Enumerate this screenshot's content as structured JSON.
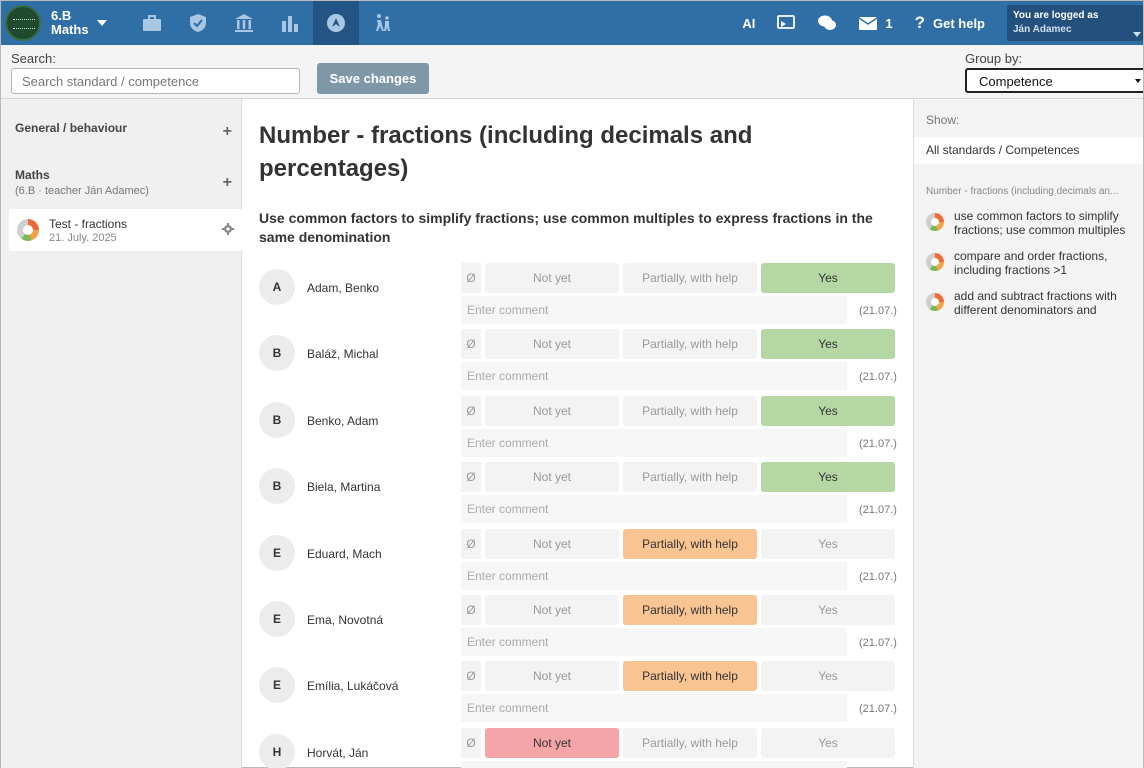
{
  "header": {
    "class_name": "6.B",
    "subject": "Maths",
    "ai_label": "AI",
    "messages_count": "1",
    "help_label": "Get help",
    "logged_in_label": "You are logged as",
    "user_name": "Ján Adamec",
    "nav_icons": [
      "briefcase-icon",
      "shield-icon",
      "building-icon",
      "bar-chart-icon",
      "rocket-badge-icon",
      "walking-people-icon"
    ]
  },
  "toolbar": {
    "search_label": "Search:",
    "search_placeholder": "Search standard / competence",
    "save_label": "Save changes",
    "group_by_label": "Group by:",
    "group_by_value": "Competence"
  },
  "sidebar": {
    "groups": [
      {
        "title": "General / behaviour",
        "subtitle": ""
      },
      {
        "title": "Maths",
        "subtitle": "(6.B · teacher Ján Adamec)"
      }
    ],
    "test_item": {
      "name": "Test - fractions",
      "date": "21. July. 2025"
    }
  },
  "main": {
    "title": "Number - fractions (including decimals and percentages)",
    "subtitle": "Use common factors to simplify fractions; use common multiples to express fractions in the same denomination",
    "option_labels": {
      "none": "Ø",
      "not_yet": "Not yet",
      "partial": "Partially, with help",
      "yes": "Yes"
    },
    "comment_placeholder": "Enter comment",
    "students": [
      {
        "initial": "A",
        "name": "Adam, Benko",
        "selected": "yes",
        "date": "(21.07.)"
      },
      {
        "initial": "B",
        "name": "Baláž, Michal",
        "selected": "yes",
        "date": "(21.07.)"
      },
      {
        "initial": "B",
        "name": "Benko, Adam",
        "selected": "yes",
        "date": "(21.07.)"
      },
      {
        "initial": "B",
        "name": "Biela, Martina",
        "selected": "yes",
        "date": "(21.07.)"
      },
      {
        "initial": "E",
        "name": "Eduard, Mach",
        "selected": "partial",
        "date": "(21.07.)"
      },
      {
        "initial": "E",
        "name": "Ema, Novotná",
        "selected": "partial",
        "date": "(21.07.)"
      },
      {
        "initial": "E",
        "name": "Emília, Lukáčová",
        "selected": "partial",
        "date": "(21.07.)"
      },
      {
        "initial": "H",
        "name": "Horvát, Ján",
        "selected": "not_yet",
        "date": ""
      }
    ]
  },
  "right": {
    "show_label": "Show:",
    "show_value": "All standards / Competences",
    "heading": "Number - fractions (including decimals an...",
    "items": [
      {
        "text": "use common factors to simplify fractions; use common multiples to..."
      },
      {
        "text": "compare and order fractions, including fractions >1"
      },
      {
        "text": "add and subtract fractions with different denominators and mixed..."
      }
    ]
  },
  "colors": {
    "topbar": "#2f6fa6",
    "yes": "#b5d7a3",
    "partial": "#f8c592",
    "not_yet": "#f5a5a8"
  }
}
